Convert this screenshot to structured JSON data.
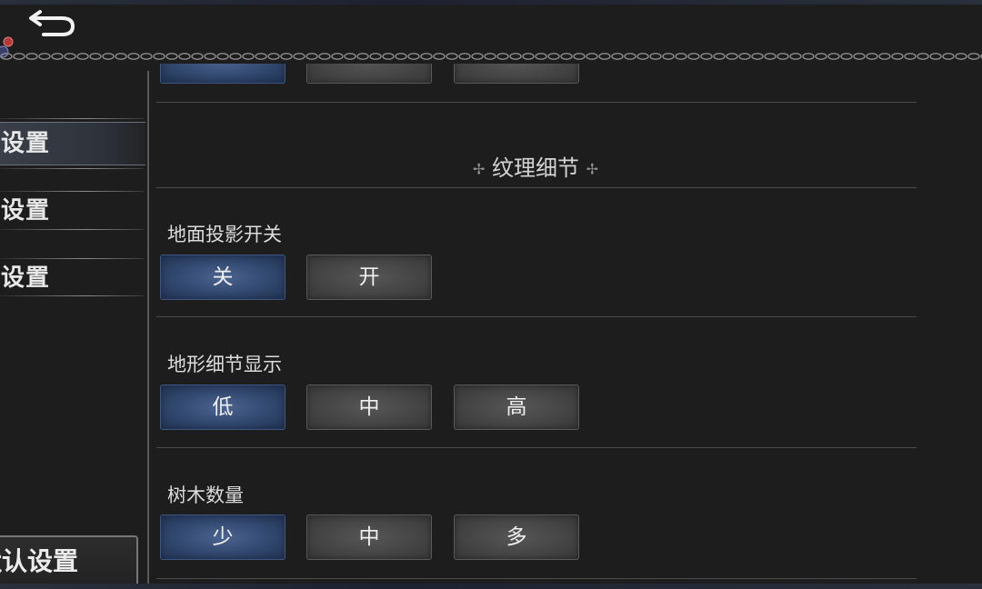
{
  "header": {
    "back_icon": "back-arrow-icon",
    "notification_icon": "notification-badge-icon"
  },
  "sidebar": {
    "items": [
      {
        "label": "频设置",
        "active": true
      },
      {
        "label": "频设置",
        "active": false
      },
      {
        "label": "戏设置",
        "active": false
      }
    ],
    "reset_label": "默认设置"
  },
  "main": {
    "section_title": "纹理细节",
    "ornament_left": "✢",
    "ornament_right": "✢",
    "settings": [
      {
        "label": "地面投影开关",
        "options": [
          "关",
          "开"
        ],
        "selected": "关"
      },
      {
        "label": "地形细节显示",
        "options": [
          "低",
          "中",
          "高"
        ],
        "selected": "低"
      },
      {
        "label": "树木数量",
        "options": [
          "少",
          "中",
          "多"
        ],
        "selected": "少"
      }
    ]
  },
  "colors": {
    "selected": "#334a71",
    "unselected": "#454545",
    "background": "#1d1d1d"
  }
}
